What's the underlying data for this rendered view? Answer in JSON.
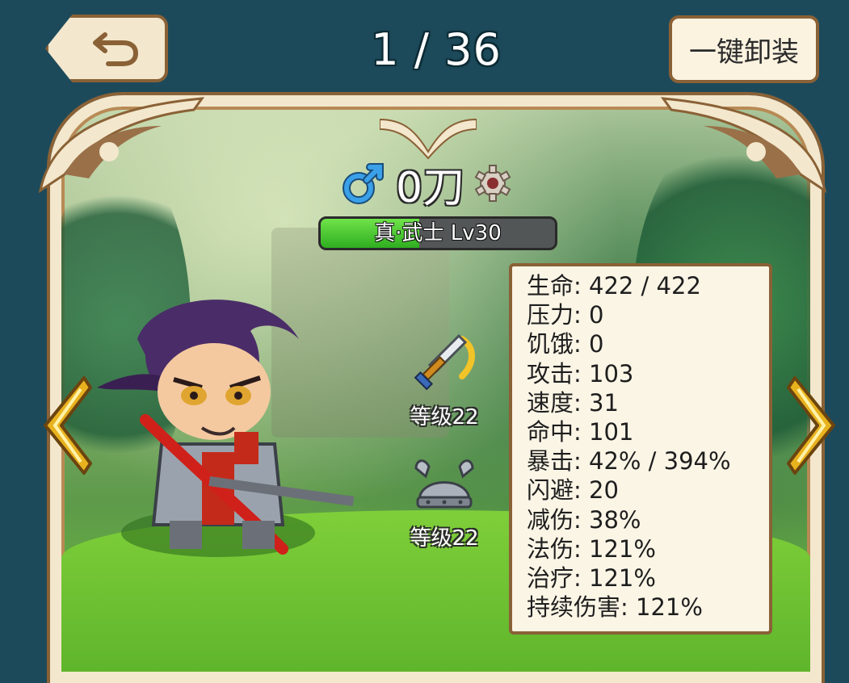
{
  "header": {
    "page_counter": "1 / 36",
    "unequip_all_label": "一键卸装"
  },
  "hero": {
    "gender": "male",
    "name": "0刀",
    "class_level": "真·武士 Lv30",
    "exp_progress": 0.42
  },
  "equipment": [
    {
      "slot": "weapon",
      "icon": "sword-icon",
      "level_label": "等级22"
    },
    {
      "slot": "helmet",
      "icon": "helmet-icon",
      "level_label": "等级22"
    }
  ],
  "stats": [
    "生命: 422 / 422",
    "压力: 0",
    "饥饿: 0",
    "攻击: 103",
    "速度: 31",
    "命中: 101",
    "暴击: 42% / 394%",
    "闪避: 20",
    "减伤: 38%",
    "法伤: 121%",
    "治疗: 121%",
    "持续伤害: 121%"
  ],
  "colors": {
    "background": "#1d4a5a",
    "frame": "#f3e7cd",
    "frame_border": "#8a6136",
    "exp_fill": "#3fbf2a",
    "gender_blue": "#3aa0e8",
    "arrow_gold": "#e8b21e"
  }
}
